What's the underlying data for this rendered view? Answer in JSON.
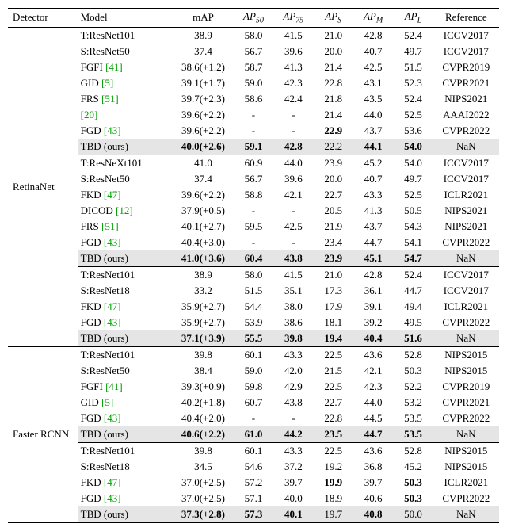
{
  "headers": {
    "detector": "Detector",
    "model": "Model",
    "map": "mAP",
    "ap50": "AP",
    "ap50_sub": "50",
    "ap75": "AP",
    "ap75_sub": "75",
    "aps": "AP",
    "aps_sub": "S",
    "apm": "AP",
    "apm_sub": "M",
    "apl": "AP",
    "apl_sub": "L",
    "reference": "Reference"
  },
  "detectors": [
    "RetinaNet",
    "Faster RCNN"
  ],
  "groups": [
    {
      "detector_index": 0,
      "rows": [
        {
          "model": "T:ResNet101",
          "map": "38.9",
          "ap50": "58.0",
          "ap75": "41.5",
          "aps": "21.0",
          "apm": "42.8",
          "apl": "52.4",
          "ref": "ICCV2017"
        },
        {
          "model": "S:ResNet50",
          "map": "37.4",
          "ap50": "56.7",
          "ap75": "39.6",
          "aps": "20.0",
          "apm": "40.7",
          "apl": "49.7",
          "ref": "ICCV2017"
        },
        {
          "model": "FGFI ",
          "cite": "[41]",
          "map": "38.6(+1.2)",
          "ap50": "58.7",
          "ap75": "41.3",
          "aps": "21.4",
          "apm": "42.5",
          "apl": "51.5",
          "ref": "CVPR2019"
        },
        {
          "model": "GID ",
          "cite": "[5]",
          "map": "39.1(+1.7)",
          "ap50": "59.0",
          "ap75": "42.3",
          "aps": "22.8",
          "apm": "43.1",
          "apl": "52.3",
          "ref": "CVPR2021"
        },
        {
          "model": "FRS ",
          "cite": "[51]",
          "map": "39.7(+2.3)",
          "ap50": "58.6",
          "ap75": "42.4",
          "aps": "21.8",
          "apm": "43.5",
          "apl": "52.4",
          "ref": "NIPS2021"
        },
        {
          "model": " ",
          "cite": "[20]",
          "map": "39.6(+2.2)",
          "ap50": "-",
          "ap75": "-",
          "aps": "21.4",
          "apm": "44.0",
          "apl": "52.5",
          "ref": "AAAI2022"
        },
        {
          "model": "FGD ",
          "cite": "[43]",
          "map": "39.6(+2.2)",
          "ap50": "-",
          "ap75": "-",
          "aps": "22.9",
          "aps_b": true,
          "apm": "43.7",
          "apl": "53.6",
          "ref": "CVPR2022"
        },
        {
          "model": "TBD (ours)",
          "hl": true,
          "map": "40.0(+2.6)",
          "map_b": true,
          "ap50": "59.1",
          "ap50_b": true,
          "ap75": "42.8",
          "ap75_b": true,
          "aps": "22.2",
          "apm": "44.1",
          "apm_b": true,
          "apl": "54.0",
          "apl_b": true,
          "ref": "NaN"
        }
      ]
    },
    {
      "detector_index": 0,
      "rows": [
        {
          "model": "T:ResNeXt101",
          "map": "41.0",
          "ap50": "60.9",
          "ap75": "44.0",
          "aps": "23.9",
          "apm": "45.2",
          "apl": "54.0",
          "ref": "ICCV2017"
        },
        {
          "model": "S:ResNet50",
          "map": "37.4",
          "ap50": "56.7",
          "ap75": "39.6",
          "aps": "20.0",
          "apm": "40.7",
          "apl": "49.7",
          "ref": "ICCV2017"
        },
        {
          "model": "FKD ",
          "cite": "[47]",
          "map": "39.6(+2.2)",
          "ap50": "58.8",
          "ap75": "42.1",
          "aps": "22.7",
          "apm": "43.3",
          "apl": "52.5",
          "ref": "ICLR2021"
        },
        {
          "model": "DICOD ",
          "cite": "[12]",
          "map": "37.9(+0.5)",
          "ap50": "-",
          "ap75": "-",
          "aps": "20.5",
          "apm": "41.3",
          "apl": "50.5",
          "ref": "NIPS2021"
        },
        {
          "model": "FRS ",
          "cite": "[51]",
          "map": "40.1(+2.7)",
          "ap50": "59.5",
          "ap75": "42.5",
          "aps": "21.9",
          "apm": "43.7",
          "apl": "54.3",
          "ref": "NIPS2021"
        },
        {
          "model": "FGD ",
          "cite": "[43]",
          "map": "40.4(+3.0)",
          "ap50": "-",
          "ap75": "-",
          "aps": "23.4",
          "apm": "44.7",
          "apl": "54.1",
          "ref": "CVPR2022"
        },
        {
          "model": "TBD (ours)",
          "hl": true,
          "map": "41.0(+3.6)",
          "map_b": true,
          "ap50": "60.4",
          "ap50_b": true,
          "ap75": "43.8",
          "ap75_b": true,
          "aps": "23.9",
          "aps_b": true,
          "apm": "45.1",
          "apm_b": true,
          "apl": "54.7",
          "apl_b": true,
          "ref": "NaN"
        }
      ]
    },
    {
      "detector_index": 0,
      "rows": [
        {
          "model": "T:ResNet101",
          "map": "38.9",
          "ap50": "58.0",
          "ap75": "41.5",
          "aps": "21.0",
          "apm": "42.8",
          "apl": "52.4",
          "ref": "ICCV2017"
        },
        {
          "model": "S:ResNet18",
          "map": "33.2",
          "ap50": "51.5",
          "ap75": "35.1",
          "aps": "17.3",
          "apm": "36.1",
          "apl": "44.7",
          "ref": "ICCV2017"
        },
        {
          "model": "FKD ",
          "cite": "[47]",
          "map": "35.9(+2.7)",
          "ap50": "54.4",
          "ap75": "38.0",
          "aps": "17.9",
          "apm": "39.1",
          "apl": "49.4",
          "ref": "ICLR2021"
        },
        {
          "model": "FGD ",
          "cite": "[43]",
          "map": "35.9(+2.7)",
          "ap50": "53.9",
          "ap75": "38.6",
          "aps": "18.1",
          "apm": "39.2",
          "apl": "49.5",
          "ref": "CVPR2022"
        },
        {
          "model": "TBD (ours)",
          "hl": true,
          "map": "37.1(+3.9)",
          "map_b": true,
          "ap50": "55.5",
          "ap50_b": true,
          "ap75": "39.8",
          "ap75_b": true,
          "aps": "19.4",
          "aps_b": true,
          "apm": "40.4",
          "apm_b": true,
          "apl": "51.6",
          "apl_b": true,
          "ref": "NaN"
        }
      ]
    },
    {
      "detector_index": 1,
      "rows": [
        {
          "model": "T:ResNet101",
          "map": "39.8",
          "ap50": "60.1",
          "ap75": "43.3",
          "aps": "22.5",
          "apm": "43.6",
          "apl": "52.8",
          "ref": "NIPS2015"
        },
        {
          "model": "S:ResNet50",
          "map": "38.4",
          "ap50": "59.0",
          "ap75": "42.0",
          "aps": "21.5",
          "apm": "42.1",
          "apl": "50.3",
          "ref": "NIPS2015"
        },
        {
          "model": "FGFI ",
          "cite": "[41]",
          "map": "39.3(+0.9)",
          "ap50": "59.8",
          "ap75": "42.9",
          "aps": "22.5",
          "apm": "42.3",
          "apl": "52.2",
          "ref": "CVPR2019"
        },
        {
          "model": "GID ",
          "cite": "[5]",
          "map": "40.2(+1.8)",
          "ap50": "60.7",
          "ap75": "43.8",
          "aps": "22.7",
          "apm": "44.0",
          "apl": "53.2",
          "ref": "CVPR2021"
        },
        {
          "model": "FGD ",
          "cite": "[43]",
          "map": "40.4(+2.0)",
          "ap50": "-",
          "ap75": "-",
          "aps": "22.8",
          "apm": "44.5",
          "apl": "53.5",
          "ref": "CVPR2022"
        },
        {
          "model": "TBD (ours)",
          "hl": true,
          "map": "40.6(+2.2)",
          "map_b": true,
          "ap50": "61.0",
          "ap50_b": true,
          "ap75": "44.2",
          "ap75_b": true,
          "aps": "23.5",
          "aps_b": true,
          "apm": "44.7",
          "apm_b": true,
          "apl": "53.5",
          "apl_b": true,
          "ref": "NaN"
        }
      ]
    },
    {
      "detector_index": 1,
      "rows": [
        {
          "model": "T:ResNet101",
          "map": "39.8",
          "ap50": "60.1",
          "ap75": "43.3",
          "aps": "22.5",
          "apm": "43.6",
          "apl": "52.8",
          "ref": "NIPS2015"
        },
        {
          "model": "S:ResNet18",
          "map": "34.5",
          "ap50": "54.6",
          "ap75": "37.2",
          "aps": "19.2",
          "apm": "36.8",
          "apl": "45.2",
          "ref": "NIPS2015"
        },
        {
          "model": "FKD ",
          "cite": "[47]",
          "map": "37.0(+2.5)",
          "ap50": "57.2",
          "ap75": "39.7",
          "aps": "19.9",
          "aps_b": true,
          "apm": "39.7",
          "apl": "50.3",
          "apl_b": true,
          "ref": "ICLR2021"
        },
        {
          "model": "FGD ",
          "cite": "[43]",
          "map": "37.0(+2.5)",
          "ap50": "57.1",
          "ap75": "40.0",
          "aps": "18.9",
          "apm": "40.6",
          "apl": "50.3",
          "apl_b": true,
          "ref": "CVPR2022"
        },
        {
          "model": "TBD (ours)",
          "hl": true,
          "map": "37.3(+2.8)",
          "map_b": true,
          "ap50": "57.3",
          "ap50_b": true,
          "ap75": "40.1",
          "ap75_b": true,
          "aps": "19.7",
          "apm": "40.8",
          "apm_b": true,
          "apl": "50.0",
          "ref": "NaN"
        }
      ]
    }
  ]
}
